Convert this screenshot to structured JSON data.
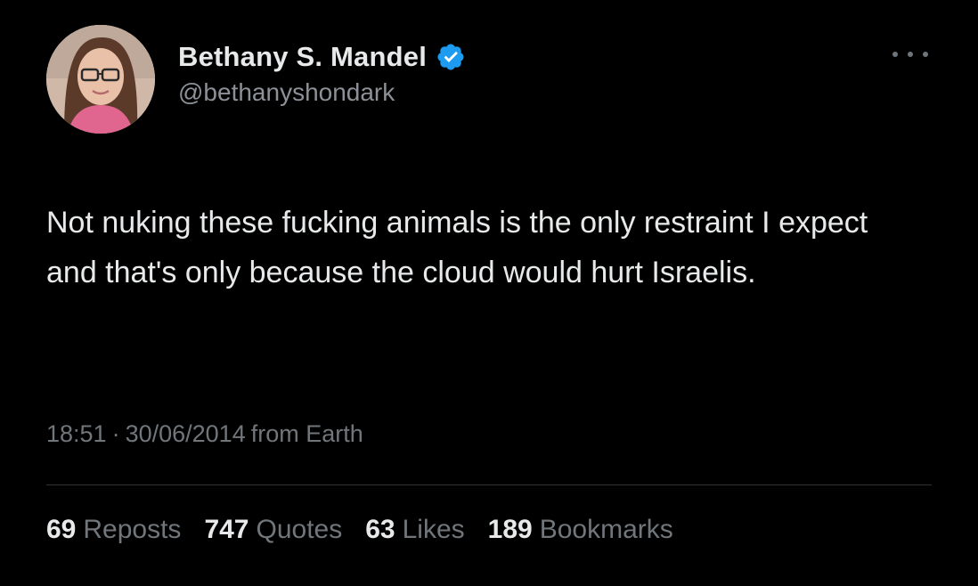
{
  "author": {
    "display_name": "Bethany S. Mandel",
    "handle": "@bethanyshondark",
    "verified": true,
    "avatar_icon": "profile-photo"
  },
  "tweet": {
    "text": "Not nuking these fucking animals is the only restraint I expect and that's only because the cloud would hurt Israelis.",
    "time": "18:51",
    "separator": "·",
    "date": "30/06/2014",
    "source": "from Earth"
  },
  "stats": [
    {
      "count": "69",
      "label": "Reposts"
    },
    {
      "count": "747",
      "label": "Quotes"
    },
    {
      "count": "63",
      "label": "Likes"
    },
    {
      "count": "189",
      "label": "Bookmarks"
    }
  ],
  "colors": {
    "background": "#000000",
    "primary_text": "#e7e9ea",
    "secondary_text": "#71767b",
    "verified_badge": "#1d9bf0",
    "divider": "#2f3336"
  },
  "icons": {
    "verified": "verified-badge-icon",
    "more": "more-options-icon"
  }
}
